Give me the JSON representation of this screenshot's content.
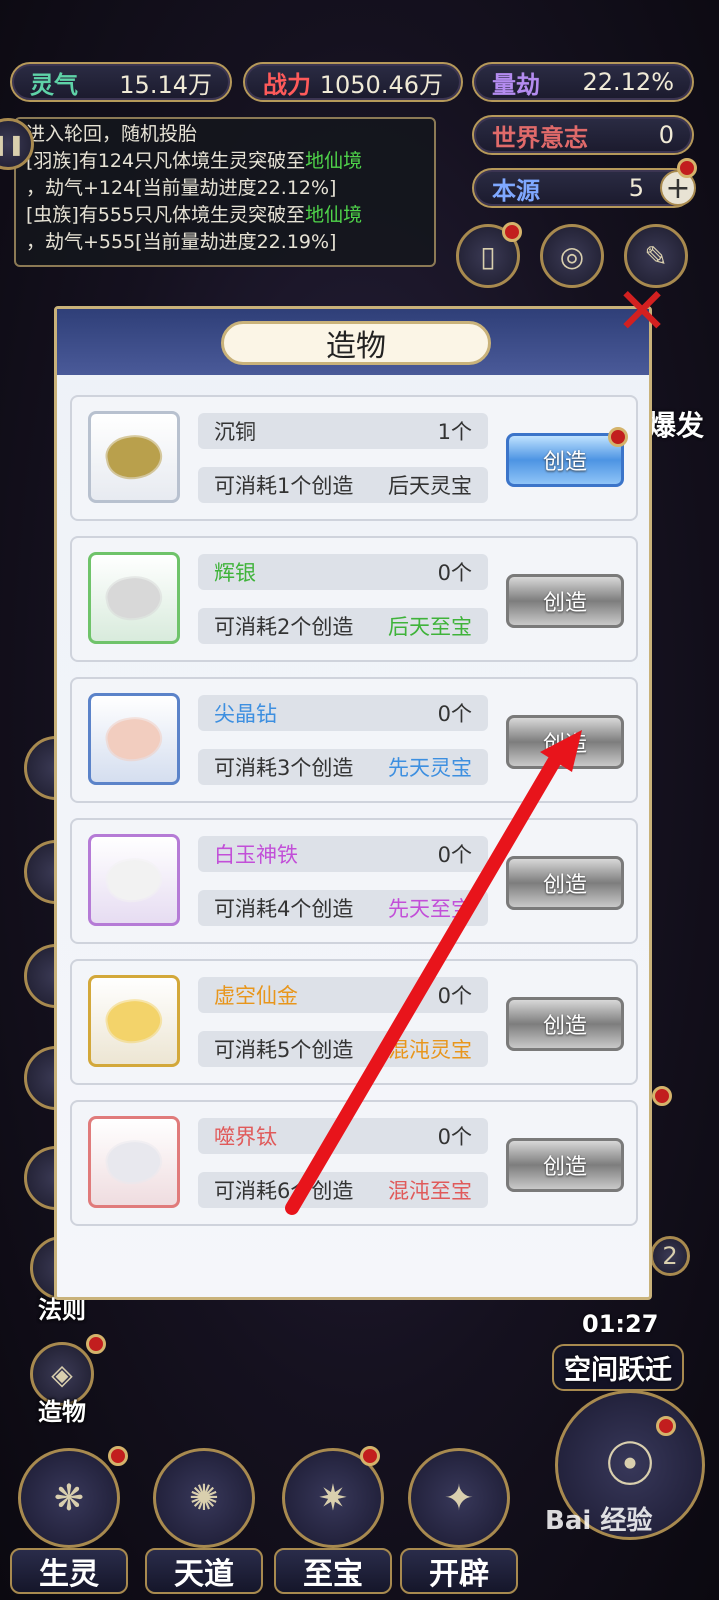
{
  "stats": {
    "lingqi": {
      "label": "灵气",
      "value": "15.14万",
      "color": "#5fd3a8"
    },
    "zhanli": {
      "label": "战力",
      "value": "1050.46万",
      "color": "#ff5a5a"
    },
    "liangjie": {
      "label": "量劫",
      "value": "22.12%",
      "color": "#b48cf0"
    },
    "shijie_yizhi": {
      "label": "世界意志",
      "value": "0",
      "color": "#e06a6a"
    },
    "benyuan": {
      "label": "本源",
      "value": "5",
      "color": "#7fa8ff"
    }
  },
  "log": {
    "line1": "进入轮回，随机投胎",
    "line2a": "[羽族]有124只凡体境生灵突破至",
    "line2b": "地仙境",
    "line3": "，劫气+124[当前量劫进度22.12%]",
    "line4a": "[虫族]有555只凡体境生灵突破至",
    "line4b": "地仙境",
    "line5": "，劫气+555[当前量劫进度22.19%]"
  },
  "dialog": {
    "title": "造物",
    "items": [
      {
        "name": "沉铜",
        "count": "1个",
        "cost": "可消耗1个创造",
        "grade": "后天灵宝",
        "name_color": "#333333",
        "grade_color": "#333333",
        "thumb_border": "#b8c1cf",
        "gem_color": "#b9a04c",
        "button": "创造",
        "active": true
      },
      {
        "name": "辉银",
        "count": "0个",
        "cost": "可消耗2个创造",
        "grade": "后天至宝",
        "name_color": "#3fb33a",
        "grade_color": "#3fb33a",
        "thumb_border": "#6fc36a",
        "gem_color": "#d8d8d8",
        "button": "创造",
        "active": false
      },
      {
        "name": "尖晶钻",
        "count": "0个",
        "cost": "可消耗3个创造",
        "grade": "先天灵宝",
        "name_color": "#3d8fe0",
        "grade_color": "#3d8fe0",
        "thumb_border": "#5b83c9",
        "gem_color": "#f2cdbf",
        "button": "创造",
        "active": false
      },
      {
        "name": "白玉神铁",
        "count": "0个",
        "cost": "可消耗4个创造",
        "grade": "先天至宝",
        "name_color": "#c24fd8",
        "grade_color": "#c24fd8",
        "thumb_border": "#b57bd6",
        "gem_color": "#f2f2f2",
        "button": "创造",
        "active": false
      },
      {
        "name": "虚空仙金",
        "count": "0个",
        "cost": "可消耗5个创造",
        "grade": "混沌灵宝",
        "name_color": "#e8961c",
        "grade_color": "#e8961c",
        "thumb_border": "#d3a83a",
        "gem_color": "#f3d36a",
        "button": "创造",
        "active": false
      },
      {
        "name": "噬界钛",
        "count": "0个",
        "cost": "可消耗6个创造",
        "grade": "混沌至宝",
        "name_color": "#e05a5a",
        "grade_color": "#e05a5a",
        "thumb_border": "#e07b7b",
        "gem_color": "#e8e8ee",
        "button": "创造",
        "active": false
      }
    ]
  },
  "left_labels": {
    "fa_ze": "法则",
    "zao_wu": "造物"
  },
  "right": {
    "timer": "01:27",
    "space_jump": "空间跃迁",
    "bao_fa": "爆发",
    "badge_num": "2"
  },
  "nav": [
    "生灵",
    "天道",
    "至宝",
    "开辟"
  ],
  "watermark": "Bai 经验"
}
